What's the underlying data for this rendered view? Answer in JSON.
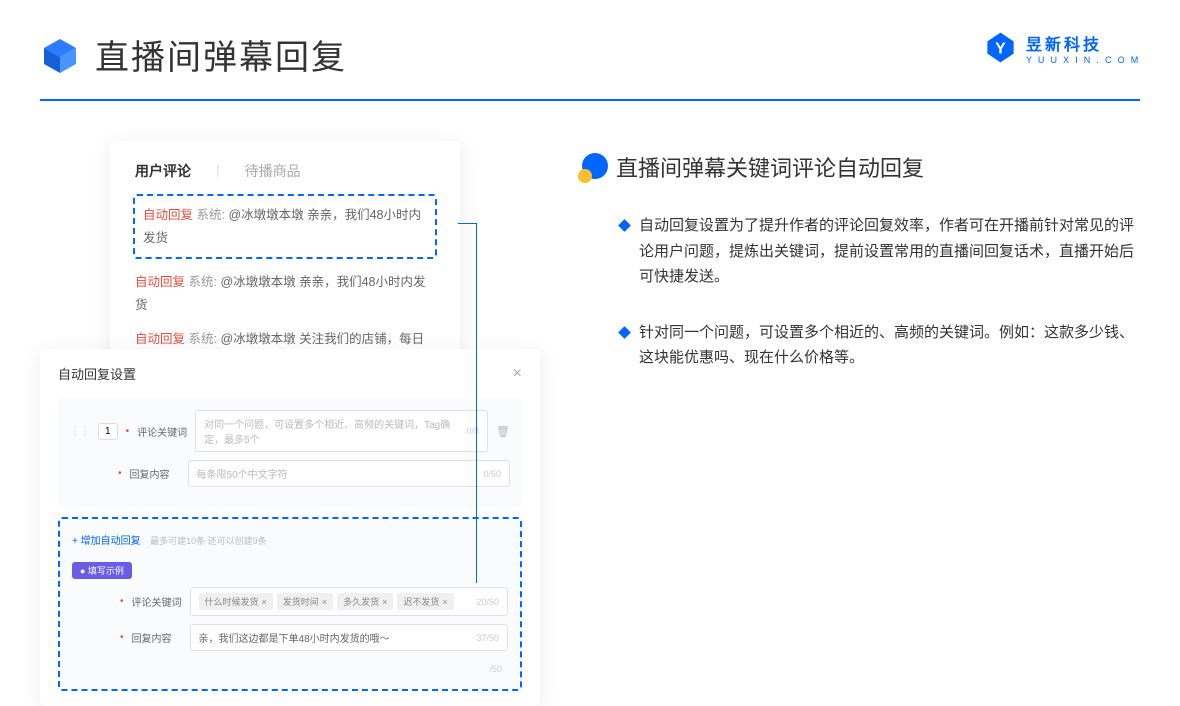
{
  "page": {
    "title": "直播间弹幕回复"
  },
  "logo": {
    "cn": "昱新科技",
    "en": "Y U U X I N . C O M"
  },
  "card1": {
    "tab1": "用户评论",
    "tab2": "待播商品",
    "row1_tag": "自动回复",
    "row1_sys": " 系统: ",
    "row1_txt": "@冰墩墩本墩 亲亲，我们48小时内发货",
    "row2_tag": "自动回复",
    "row2_sys": " 系统: ",
    "row2_txt": "@冰墩墩本墩 亲亲，我们48小时内发货",
    "row3_tag": "自动回复",
    "row3_sys": " 系统: ",
    "row3_txt": "@冰墩墩本墩 关注我们的店铺，每日都有热门推荐呦～"
  },
  "card2": {
    "title": "自动回复设置",
    "num": "1",
    "label1": "评论关键词",
    "placeholder1": "对同一个问题，可设置多个相近、高频的关键词，Tag确定，最多5个",
    "cnt1": "0/8",
    "label2": "回复内容",
    "placeholder2": "每条限50个中文字符",
    "cnt2": "0/50",
    "add": "+ 增加自动回复",
    "hint": "最多可建10条 还可以创建9条",
    "purple": "● 填写示例",
    "ex_label1": "评论关键词",
    "tag1": "什么时候发货",
    "tag2": "发货时间",
    "tag3": "多久发货",
    "tag4": "迟不发货",
    "ex_cnt1": "20/50",
    "ex_label2": "回复内容",
    "ex_txt": "亲，我们这边都是下单48小时内发货的哦～",
    "ex_cnt2": "37/50",
    "floor_cnt": "/50"
  },
  "right": {
    "heading": "直播间弹幕关键词评论自动回复",
    "b1": "自动回复设置为了提升作者的评论回复效率，作者可在开播前针对常见的评论用户问题，提炼出关键词，提前设置常用的直播间回复话术，直播开始后可快捷发送。",
    "b2": "针对同一个问题，可设置多个相近的、高频的关键词。例如：这款多少钱、这块能优惠吗、现在什么价格等。"
  }
}
